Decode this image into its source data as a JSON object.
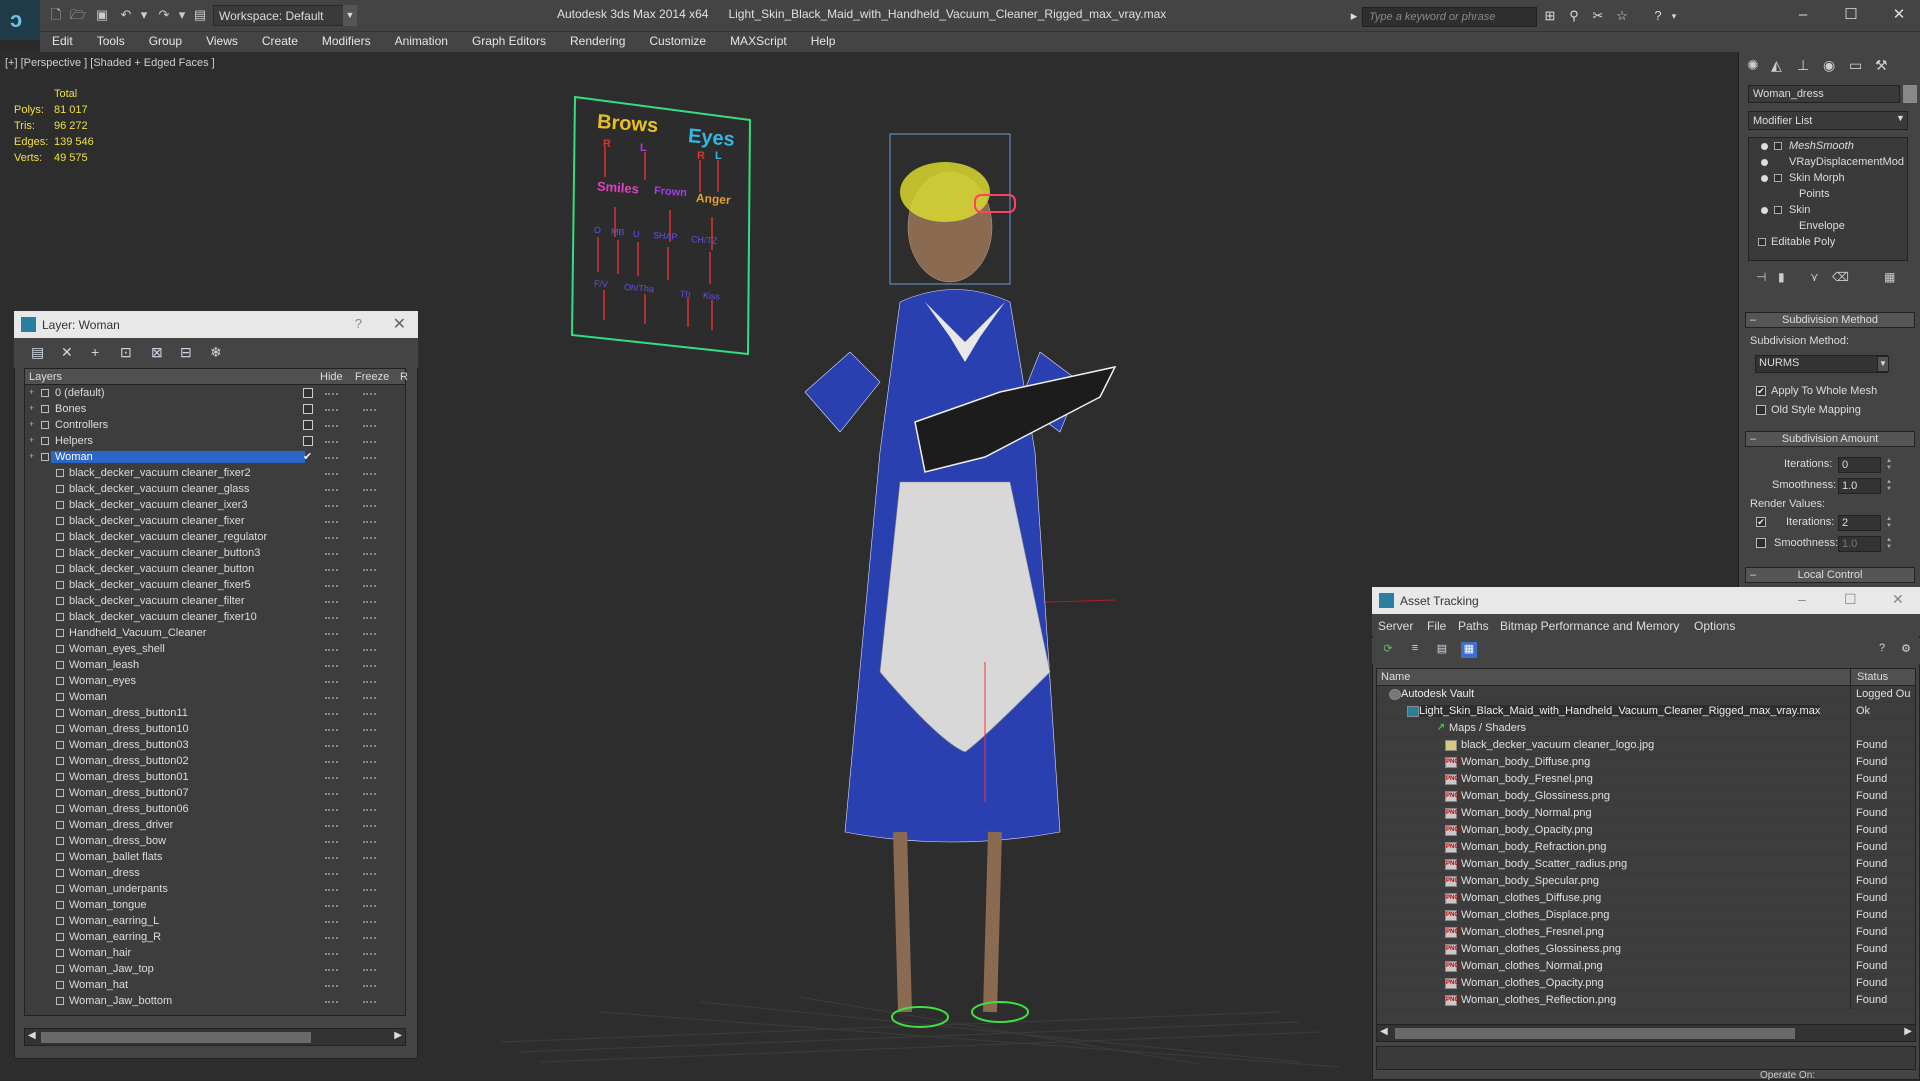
{
  "app": {
    "title": "Autodesk 3ds Max 2014 x64",
    "file": "Light_Skin_Black_Maid_with_Handheld_Vacuum_Cleaner_Rigged_max_vray.max",
    "workspace": "Workspace: Default",
    "search_placeholder": "Type a keyword or phrase"
  },
  "menu": [
    "Edit",
    "Tools",
    "Group",
    "Views",
    "Create",
    "Modifiers",
    "Animation",
    "Graph Editors",
    "Rendering",
    "Customize",
    "MAXScript",
    "Help"
  ],
  "viewport": {
    "label": "[+] [Perspective ] [Shaded + Edged Faces ]",
    "stats": {
      "total_label": "Total",
      "rows": [
        {
          "label": "Polys:",
          "value": "81 017"
        },
        {
          "label": "Tris:",
          "value": "96 272"
        },
        {
          "label": "Edges:",
          "value": "139 546"
        },
        {
          "label": "Verts:",
          "value": "49 575"
        }
      ]
    },
    "face_board": {
      "brows": "Brows",
      "eyes": "Eyes",
      "smiles": "Smiles",
      "anger": "Anger",
      "r": "R",
      "l": "L",
      "r2": "R",
      "l2": "L",
      "frown": "Frown",
      "row3": [
        "O",
        "MB",
        "U",
        "SHAP",
        "CH/TZ"
      ],
      "row4": [
        "F/V",
        "Oh/Tha",
        "Th",
        "Kiss"
      ]
    }
  },
  "layer_window": {
    "title": "Layer: Woman",
    "help": "?",
    "columns": {
      "layers": "Layers",
      "hide": "Hide",
      "freeze": "Freeze",
      "render": "R"
    },
    "layers": [
      {
        "name": "0 (default)",
        "kind": "layer",
        "check": true
      },
      {
        "name": "Bones",
        "kind": "layer",
        "check": true
      },
      {
        "name": "Controllers",
        "kind": "layer",
        "check": true
      },
      {
        "name": "Helpers",
        "kind": "layer",
        "check": true
      },
      {
        "name": "Woman",
        "kind": "layer",
        "selected": true,
        "active": "✔"
      },
      {
        "name": "black_decker_vacuum cleaner_fixer2",
        "kind": "obj"
      },
      {
        "name": "black_decker_vacuum cleaner_glass",
        "kind": "obj"
      },
      {
        "name": "black_decker_vacuum cleaner_ixer3",
        "kind": "obj"
      },
      {
        "name": "black_decker_vacuum cleaner_fixer",
        "kind": "obj"
      },
      {
        "name": "black_decker_vacuum cleaner_regulator",
        "kind": "obj"
      },
      {
        "name": "black_decker_vacuum cleaner_button3",
        "kind": "obj"
      },
      {
        "name": "black_decker_vacuum cleaner_button",
        "kind": "obj"
      },
      {
        "name": "black_decker_vacuum cleaner_fixer5",
        "kind": "obj"
      },
      {
        "name": "black_decker_vacuum cleaner_filter",
        "kind": "obj"
      },
      {
        "name": "black_decker_vacuum cleaner_fixer10",
        "kind": "obj"
      },
      {
        "name": "Handheld_Vacuum_Cleaner",
        "kind": "obj"
      },
      {
        "name": "Woman_eyes_shell",
        "kind": "obj"
      },
      {
        "name": "Woman_leash",
        "kind": "obj"
      },
      {
        "name": "Woman_eyes",
        "kind": "obj"
      },
      {
        "name": "Woman",
        "kind": "obj"
      },
      {
        "name": "Woman_dress_button11",
        "kind": "obj"
      },
      {
        "name": "Woman_dress_button10",
        "kind": "obj"
      },
      {
        "name": "Woman_dress_button03",
        "kind": "obj"
      },
      {
        "name": "Woman_dress_button02",
        "kind": "obj"
      },
      {
        "name": "Woman_dress_button01",
        "kind": "obj"
      },
      {
        "name": "Woman_dress_button07",
        "kind": "obj"
      },
      {
        "name": "Woman_dress_button06",
        "kind": "obj"
      },
      {
        "name": "Woman_dress_driver",
        "kind": "obj"
      },
      {
        "name": "Woman_dress_bow",
        "kind": "obj"
      },
      {
        "name": "Woman_ballet flats",
        "kind": "obj"
      },
      {
        "name": "Woman_dress",
        "kind": "obj"
      },
      {
        "name": "Woman_underpants",
        "kind": "obj"
      },
      {
        "name": "Woman_tongue",
        "kind": "obj"
      },
      {
        "name": "Woman_earring_L",
        "kind": "obj"
      },
      {
        "name": "Woman_earring_R",
        "kind": "obj"
      },
      {
        "name": "Woman_hair",
        "kind": "obj"
      },
      {
        "name": "Woman_Jaw_top",
        "kind": "obj"
      },
      {
        "name": "Woman_hat",
        "kind": "obj"
      },
      {
        "name": "Woman_Jaw_bottom",
        "kind": "obj"
      }
    ]
  },
  "command_panel": {
    "object_name": "Woman_dress",
    "modifier_list": "Modifier List",
    "stack": [
      "MeshSmooth",
      "VRayDisplacementMod",
      "Skin Morph",
      "Points",
      "Skin",
      "Envelope",
      "Editable Poly"
    ],
    "subdivision_method": {
      "title": "Subdivision Method",
      "label": "Subdivision Method:",
      "value": "NURMS",
      "apply_whole": "Apply To Whole Mesh",
      "apply_whole_checked": true,
      "old_style": "Old Style Mapping",
      "old_style_checked": false
    },
    "subdivision_amount": {
      "title": "Subdivision Amount",
      "iterations_label": "Iterations:",
      "iterations": "0",
      "smoothness_label": "Smoothness:",
      "smoothness": "1.0",
      "render_values": "Render Values:",
      "r_iterations_label": "Iterations:",
      "r_iterations": "2",
      "r_iterations_checked": true,
      "r_smoothness_label": "Smoothness:",
      "r_smoothness": "1.0",
      "r_smoothness_checked": false
    },
    "local_control": "Local Control"
  },
  "asset_tracking": {
    "title": "Asset Tracking",
    "menu": [
      "Server",
      "File",
      "Paths",
      "Bitmap Performance and Memory",
      "Options"
    ],
    "columns": {
      "name": "Name",
      "status": "Status"
    },
    "rows": [
      {
        "name": "Autodesk Vault",
        "status": "Logged Ou",
        "kind": "vault"
      },
      {
        "name": "Light_Skin_Black_Maid_with_Handheld_Vacuum_Cleaner_Rigged_max_vray.max",
        "status": "Ok",
        "kind": "maxf"
      },
      {
        "name": "Maps / Shaders",
        "status": "",
        "kind": "folder"
      },
      {
        "name": "black_decker_vacuum cleaner_logo.jpg",
        "status": "Found",
        "kind": "jpg"
      },
      {
        "name": "Woman_body_Diffuse.png",
        "status": "Found",
        "kind": "png"
      },
      {
        "name": "Woman_body_Fresnel.png",
        "status": "Found",
        "kind": "png"
      },
      {
        "name": "Woman_body_Glossiness.png",
        "status": "Found",
        "kind": "png"
      },
      {
        "name": "Woman_body_Normal.png",
        "status": "Found",
        "kind": "png"
      },
      {
        "name": "Woman_body_Opacity.png",
        "status": "Found",
        "kind": "png"
      },
      {
        "name": "Woman_body_Refraction.png",
        "status": "Found",
        "kind": "png"
      },
      {
        "name": "Woman_body_Scatter_radius.png",
        "status": "Found",
        "kind": "png"
      },
      {
        "name": "Woman_body_Specular.png",
        "status": "Found",
        "kind": "png"
      },
      {
        "name": "Woman_clothes_Diffuse.png",
        "status": "Found",
        "kind": "png"
      },
      {
        "name": "Woman_clothes_Displace.png",
        "status": "Found",
        "kind": "png"
      },
      {
        "name": "Woman_clothes_Fresnel.png",
        "status": "Found",
        "kind": "png"
      },
      {
        "name": "Woman_clothes_Glossiness.png",
        "status": "Found",
        "kind": "png"
      },
      {
        "name": "Woman_clothes_Normal.png",
        "status": "Found",
        "kind": "png"
      },
      {
        "name": "Woman_clothes_Opacity.png",
        "status": "Found",
        "kind": "png"
      },
      {
        "name": "Woman_clothes_Reflection.png",
        "status": "Found",
        "kind": "png"
      }
    ]
  },
  "status_bar": {
    "hint": "Operate On:"
  }
}
